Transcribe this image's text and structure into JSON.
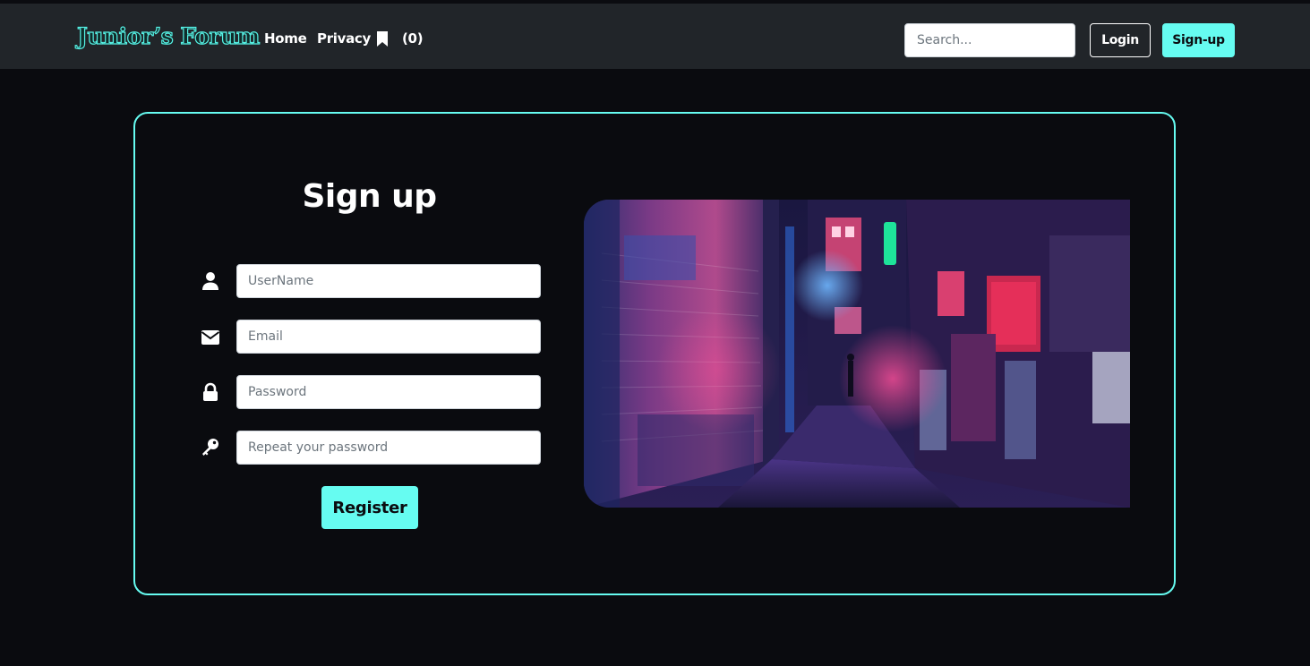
{
  "navbar": {
    "brand": "Junior’s Forum",
    "links": [
      "Home",
      "Privacy"
    ],
    "bookmark_icon": "bookmark-icon",
    "bookmark_count": "(0)",
    "search_placeholder": "Search...",
    "login_label": "Login",
    "signup_label": "Sign-up"
  },
  "form": {
    "title": "Sign up",
    "fields": [
      {
        "icon": "user-icon",
        "placeholder": "UserName",
        "value": ""
      },
      {
        "icon": "envelope-icon",
        "placeholder": "Email",
        "value": ""
      },
      {
        "icon": "lock-icon",
        "placeholder": "Password",
        "value": ""
      },
      {
        "icon": "key-icon",
        "placeholder": "Repeat your password",
        "value": ""
      }
    ],
    "submit_label": "Register"
  },
  "hero_image": {
    "subject": "neon-lit night alley photo",
    "alt": ""
  },
  "colors": {
    "accent": "#66fcf1",
    "navbar_bg": "#212529",
    "page_bg": "#0a0b0f"
  }
}
